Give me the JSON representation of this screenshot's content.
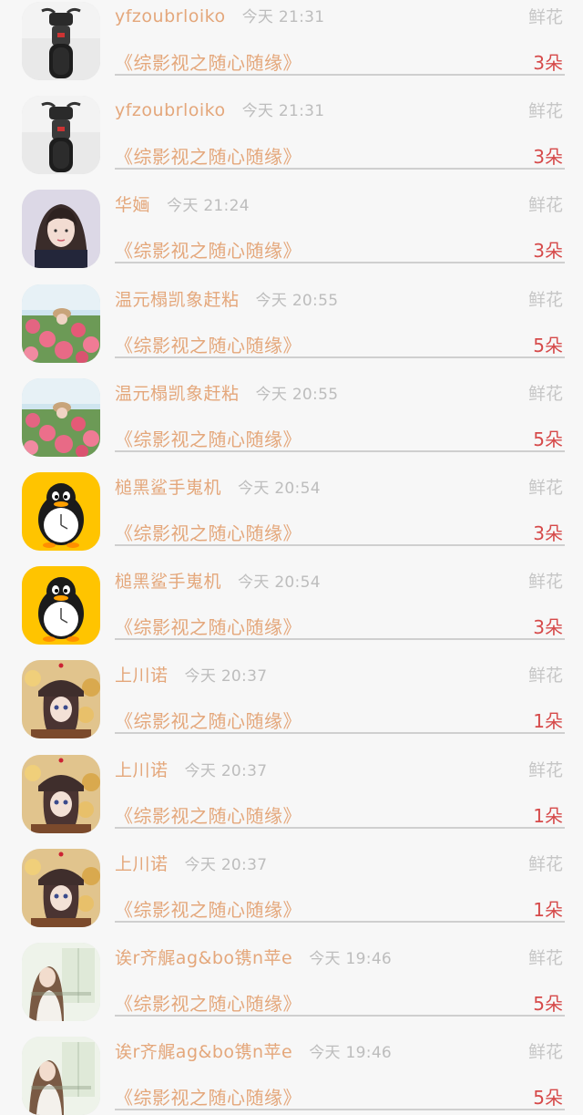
{
  "items": [
    {
      "name": "yfzoubrloiko",
      "time": "今天 21:31",
      "gift": "鲜花",
      "work": "《综影视之随心随缘》",
      "count": "3朵",
      "avatar": "motorbike"
    },
    {
      "name": "yfzoubrloiko",
      "time": "今天 21:31",
      "gift": "鲜花",
      "work": "《综影视之随心随缘》",
      "count": "3朵",
      "avatar": "motorbike"
    },
    {
      "name": "华婳",
      "time": "今天 21:24",
      "gift": "鲜花",
      "work": "《综影视之随心随缘》",
      "count": "3朵",
      "avatar": "girl-portrait"
    },
    {
      "name": "温元榻凯象赶粘",
      "time": "今天 20:55",
      "gift": "鲜花",
      "work": "《综影视之随心随缘》",
      "count": "5朵",
      "avatar": "flower-garden"
    },
    {
      "name": "温元榻凯象赶粘",
      "time": "今天 20:55",
      "gift": "鲜花",
      "work": "《综影视之随心随缘》",
      "count": "5朵",
      "avatar": "flower-garden"
    },
    {
      "name": "槌黑鲨手嵬机",
      "time": "今天 20:54",
      "gift": "鲜花",
      "work": "《综影视之随心随缘》",
      "count": "3朵",
      "avatar": "penguin"
    },
    {
      "name": "槌黑鲨手嵬机",
      "time": "今天 20:54",
      "gift": "鲜花",
      "work": "《综影视之随心随缘》",
      "count": "3朵",
      "avatar": "penguin"
    },
    {
      "name": "上川诺",
      "time": "今天 20:37",
      "gift": "鲜花",
      "work": "《综影视之随心随缘》",
      "count": "1朵",
      "avatar": "anime-girl"
    },
    {
      "name": "上川诺",
      "time": "今天 20:37",
      "gift": "鲜花",
      "work": "《综影视之随心随缘》",
      "count": "1朵",
      "avatar": "anime-girl"
    },
    {
      "name": "上川诺",
      "time": "今天 20:37",
      "gift": "鲜花",
      "work": "《综影视之随心随缘》",
      "count": "1朵",
      "avatar": "anime-girl"
    },
    {
      "name": "诶r齐艉ag&bo镌n苹e",
      "time": "今天 19:46",
      "gift": "鲜花",
      "work": "《综影视之随心随缘》",
      "count": "5朵",
      "avatar": "window-girl"
    },
    {
      "name": "诶r齐艉ag&bo镌n苹e",
      "time": "今天 19:46",
      "gift": "鲜花",
      "work": "《综影视之随心随缘》",
      "count": "5朵",
      "avatar": "window-girl"
    }
  ],
  "colors": {
    "name": "#e4a77b",
    "time": "#bdbdbd",
    "gift": "#c6c6c6",
    "count": "#d64a4a",
    "divider": "#cfcfcf",
    "background": "#f7f7f7"
  }
}
